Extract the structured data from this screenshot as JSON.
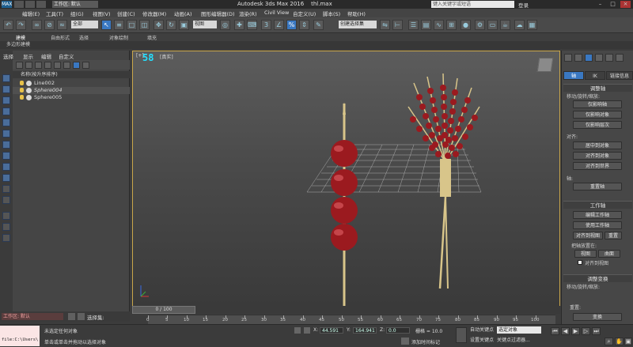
{
  "app": {
    "title": "Autodesk 3ds Max 2016",
    "file": "thl.max",
    "workspace_label": "工作区: 默认",
    "search_placeholder": "键入关键字或短语",
    "login": "登录",
    "logo_text": "MAX"
  },
  "menu": [
    "编辑(E)",
    "工具(T)",
    "组(G)",
    "视图(V)",
    "创建(C)",
    "修改器(M)",
    "动画(A)",
    "图形编辑器(D)",
    "渲染(R)",
    "Civil View",
    "自定义(U)",
    "脚本(S)",
    "帮助(H)"
  ],
  "toolbar": {
    "selection_filter": "全部",
    "ref_coord": "视图",
    "named_selection": "创建选择集"
  },
  "ribbon": {
    "tabs": [
      "建模",
      "自由形式",
      "选择",
      "对象绘制",
      "填充"
    ],
    "subtitle": "多边形建模"
  },
  "explorer": {
    "menus": [
      "选择",
      "显示",
      "编辑",
      "自定义"
    ],
    "header": "名称(按升序排序)",
    "items": [
      {
        "name": "Line002",
        "italic": false
      },
      {
        "name": "Sphere004",
        "italic": true
      },
      {
        "name": "Sphere005",
        "italic": false
      }
    ]
  },
  "viewport": {
    "label": "[+]",
    "fps": "58",
    "shading": "[真实]",
    "scene_colors": {
      "candy": "#9b1a1f",
      "stick": "#d8c58a",
      "grid": "#c8c8c8"
    }
  },
  "command_panel": {
    "tabs": [
      "轴",
      "IK",
      "链接信息"
    ],
    "rollout1": {
      "title": "调整轴",
      "group1": "移动/旋转/缩放:",
      "buttons1": [
        "仅影响轴",
        "仅影响对象",
        "仅影响层次"
      ],
      "group2": "对齐:",
      "buttons2": [
        "居中到对象",
        "对齐到对象",
        "对齐到世界"
      ],
      "group3": "轴:",
      "button3": "重置轴"
    },
    "rollout2": {
      "title": "工作轴",
      "buttons": [
        "编辑工作轴",
        "使用工作轴"
      ],
      "align_view": "对齐到视图",
      "reset": "重置",
      "place_label": "把轴放置在:",
      "view": "视图",
      "surface": "曲面",
      "checkbox": "对齐到视图"
    },
    "rollout3": {
      "title": "调整变换",
      "group": "移动/旋转/缩放:",
      "reset_label": "重置:",
      "transform": "变换"
    }
  },
  "timeline": {
    "frame": "0 / 100",
    "ticks": [
      "0",
      "5",
      "10",
      "15",
      "20",
      "25",
      "30",
      "35",
      "40",
      "45",
      "50",
      "55",
      "60",
      "65",
      "70",
      "75",
      "80",
      "85",
      "90",
      "95",
      "100"
    ]
  },
  "status": {
    "maxscript": "file:C:\\Users\\",
    "selected": "选择集:",
    "msg1": "未选定任何对象",
    "msg2": "单击或单击并拖动以选择对象",
    "x_label": "X:",
    "x": "44.591",
    "y_label": "Y:",
    "y": "164.941",
    "z_label": "Z:",
    "z": "0.0",
    "grid": "栅格 = 10.0",
    "auto_key": "自动关键点",
    "set_key": "设置关键点",
    "key_mode": "选定对象",
    "key_filters": "关键点过滤器...",
    "add_tag": "添加时间标记"
  }
}
